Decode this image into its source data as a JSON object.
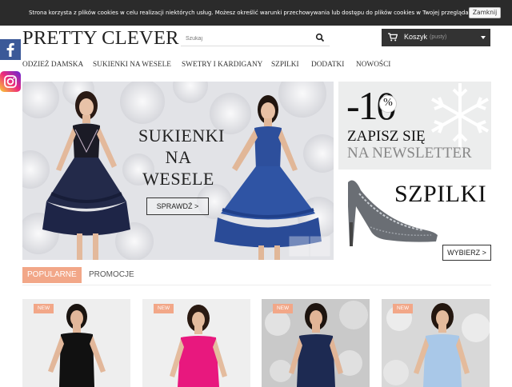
{
  "cookie": {
    "text": "Strona korzysta z plików cookies w celu realizacji niektórych usług. Możesz określić warunki przechowywania lub dostępu do plików cookies w Twojej przeglądarce.",
    "close_label": "Zamknij"
  },
  "header": {
    "logo": "PRETTY CLEVER",
    "search_placeholder": "Szukaj",
    "cart_label": "Koszyk",
    "cart_status": "(pusty)"
  },
  "social": {
    "facebook_icon": "facebook-icon",
    "instagram_icon": "instagram-icon"
  },
  "nav": {
    "items": [
      {
        "label": "ODZIEŻ DAMSKA"
      },
      {
        "label": "SUKIENKI NA WESELE"
      },
      {
        "label": "SWETRY I KARDIGANY"
      },
      {
        "label": "SZPILKI"
      },
      {
        "label": "DODATKI"
      },
      {
        "label": "NOWOŚCI"
      }
    ]
  },
  "hero": {
    "line1": "SUKIENKI",
    "line2": "NA",
    "line3": "WESELE",
    "button": "SPRAWDŹ >"
  },
  "promo_newsletter": {
    "discount_sign": "-10",
    "percent": "%",
    "line1": "ZAPISZ SIĘ",
    "line2": "NA NEWSLETTER"
  },
  "promo_heels": {
    "title": "SZPILKI",
    "button": "WYBIERZ >"
  },
  "tabs": [
    {
      "label": "POPULARNE",
      "active": true
    },
    {
      "label": "PROMOCJE",
      "active": false
    }
  ],
  "products": [
    {
      "badge": "NEW",
      "dress_color": "#111111",
      "bg": "#eeeeee"
    },
    {
      "badge": "NEW",
      "dress_color": "#e8187e",
      "bg": "#efefef"
    },
    {
      "badge": "NEW",
      "dress_color": "#1d2a52",
      "bg": "#c9c9c9"
    },
    {
      "badge": "NEW",
      "dress_color": "#a9c8e8",
      "bg": "#d8d8d8"
    }
  ],
  "colors": {
    "accent": "#f2a788",
    "dark": "#333333",
    "navy": "#1f2e5e",
    "blue": "#2c4f9e"
  }
}
